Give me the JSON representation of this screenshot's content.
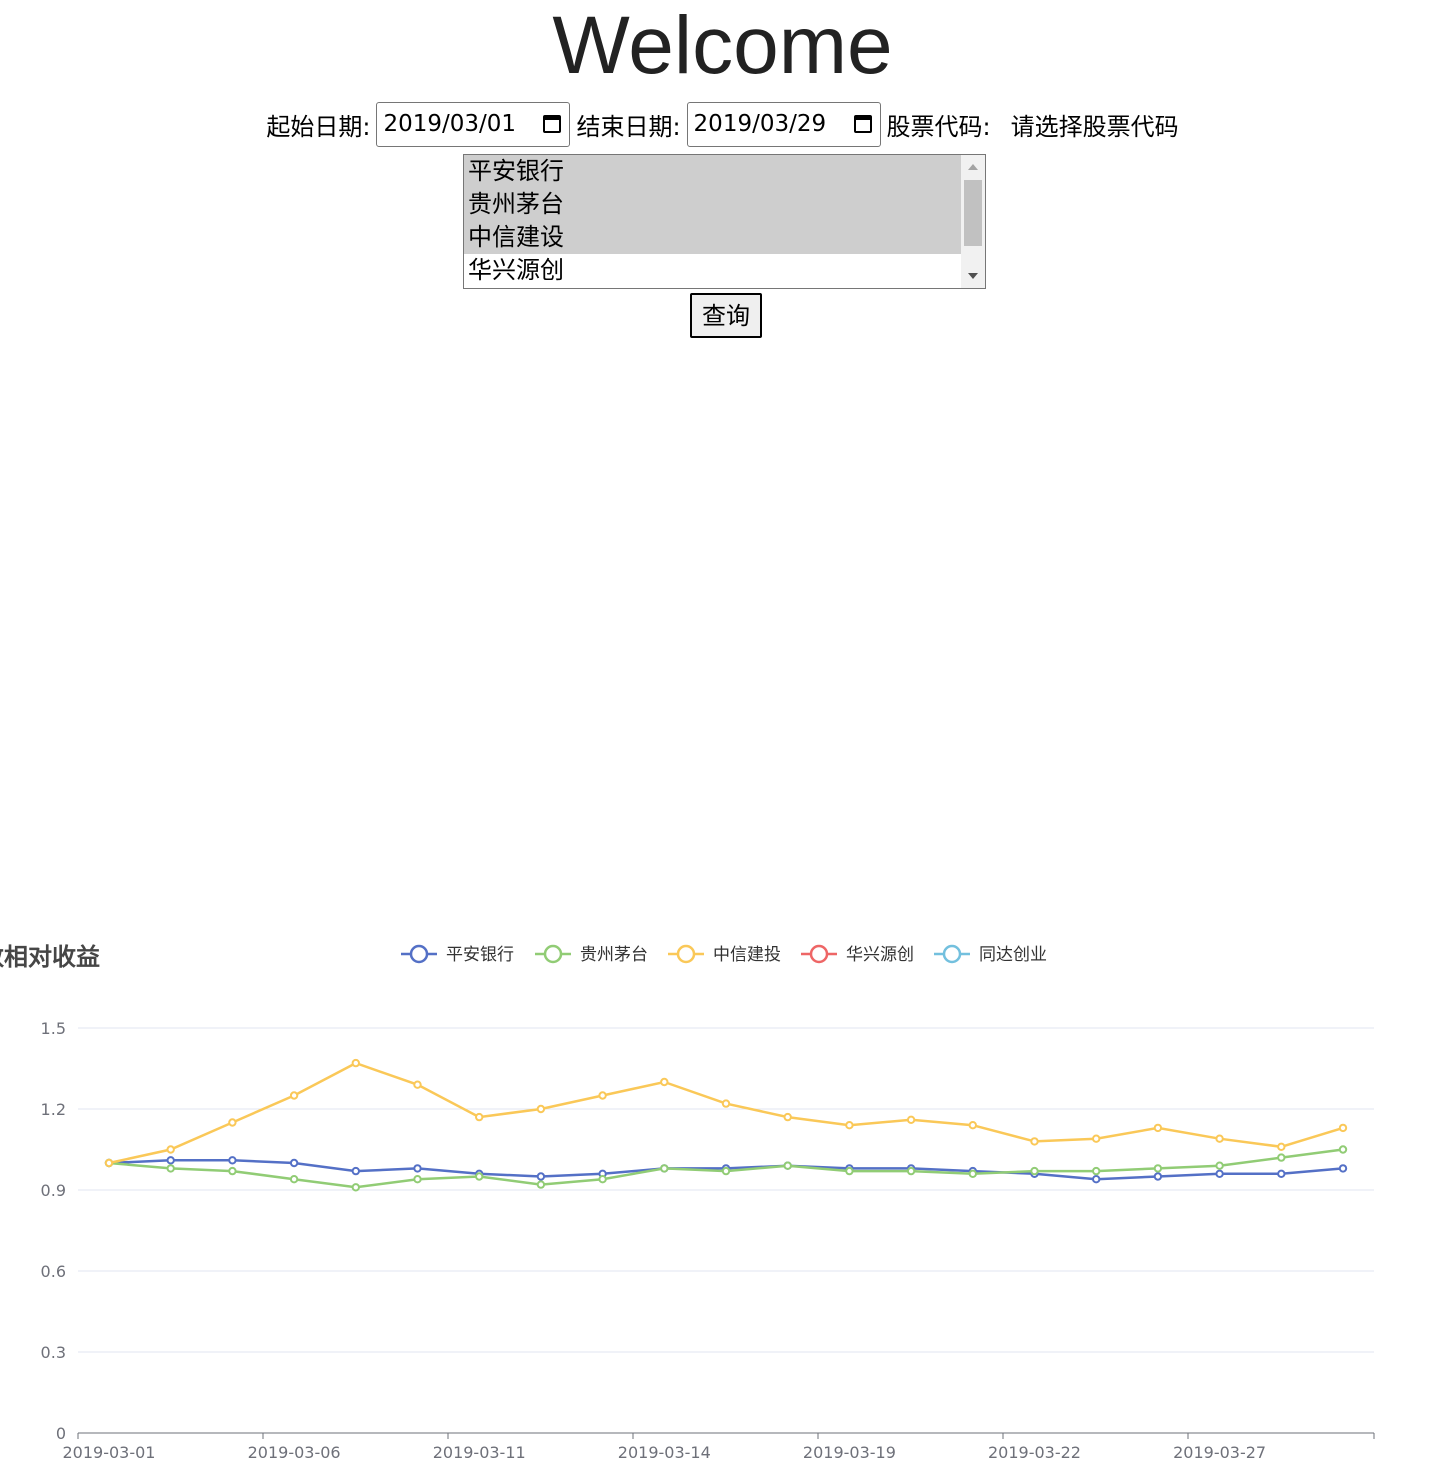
{
  "page": {
    "title": "Welcome"
  },
  "form": {
    "start_label": "起始日期:",
    "start_value": "2019/03/01",
    "end_label": "结束日期:",
    "end_value": "2019/03/29",
    "code_label": "股票代码:",
    "code_placeholder": "请选择股票代码",
    "options": [
      {
        "label": "平安银行",
        "selected": true
      },
      {
        "label": "贵州茅台",
        "selected": true
      },
      {
        "label": "中信建设",
        "selected": true
      },
      {
        "label": "华兴源创",
        "selected": false
      }
    ],
    "query_label": "查询"
  },
  "chart_data": {
    "type": "line",
    "title": "数相对收益",
    "ylim": [
      0,
      1.5
    ],
    "yticks": [
      "0",
      "0.3",
      "0.6",
      "0.9",
      "1.2",
      "1.5"
    ],
    "xtick_labels": [
      "2019-03-01",
      "2019-03-06",
      "2019-03-11",
      "2019-03-14",
      "2019-03-19",
      "2019-03-22",
      "2019-03-27"
    ],
    "legend_position": "top-center",
    "grid": true,
    "series": [
      {
        "name": "平安银行",
        "color": "#5470c6",
        "values": [
          1.0,
          1.01,
          1.01,
          1.0,
          0.97,
          0.98,
          0.96,
          0.95,
          0.96,
          0.98,
          0.98,
          0.99,
          0.98,
          0.98,
          0.97,
          0.96,
          0.94,
          0.95,
          0.96,
          0.96,
          0.98
        ]
      },
      {
        "name": "贵州茅台",
        "color": "#91cc75",
        "values": [
          1.0,
          0.98,
          0.97,
          0.94,
          0.91,
          0.94,
          0.95,
          0.92,
          0.94,
          0.98,
          0.97,
          0.99,
          0.97,
          0.97,
          0.96,
          0.97,
          0.97,
          0.98,
          0.99,
          1.02,
          1.05
        ]
      },
      {
        "name": "中信建投",
        "color": "#fac858",
        "values": [
          1.0,
          1.05,
          1.15,
          1.25,
          1.37,
          1.29,
          1.17,
          1.2,
          1.25,
          1.3,
          1.22,
          1.17,
          1.14,
          1.16,
          1.14,
          1.08,
          1.09,
          1.13,
          1.09,
          1.06,
          1.13
        ]
      },
      {
        "name": "华兴源创",
        "color": "#ee6666",
        "values": []
      },
      {
        "name": "同达创业",
        "color": "#73c0de",
        "values": []
      }
    ]
  }
}
